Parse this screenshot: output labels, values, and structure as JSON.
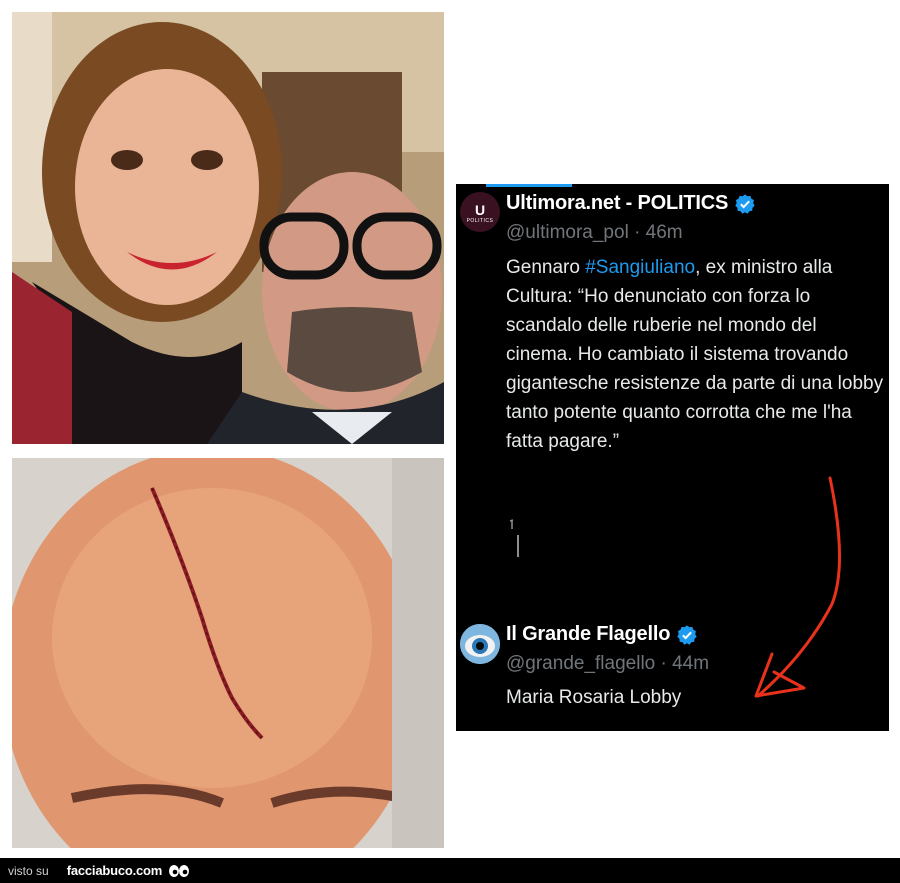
{
  "tweets": [
    {
      "name": "Ultimora.net - POLITICS",
      "handle_time": "@ultimora_pol · 46m",
      "avatar_text": "U",
      "avatar_subtext": "POLITICS",
      "body_before": "Gennaro ",
      "hashtag": "#Sangiuliano",
      "body_after": ", ex ministro alla Cultura: “Ho denunciato con forza lo scandalo delle ruberie nel mondo del cinema. Ho cambiato il sistema trovando gigantesche resistenze da parte di una lobby tanto potente quanto corrotta che me l'ha fatta pagare.”"
    },
    {
      "name": "Il Grande Flagello",
      "handle_time": "@grande_flagello · 44m",
      "body": "Maria Rosaria Lobby"
    }
  ],
  "footer": {
    "visto": "visto su",
    "brand": "facciabuco.com"
  },
  "colors": {
    "card_bg": "#000000",
    "verified": "#1d9bf0",
    "hashtag": "#1d9bf0",
    "arrow": "#e8321c",
    "footer_bg": "#000000"
  },
  "icons": [
    "verified-badge-icon",
    "eyes-icon"
  ]
}
